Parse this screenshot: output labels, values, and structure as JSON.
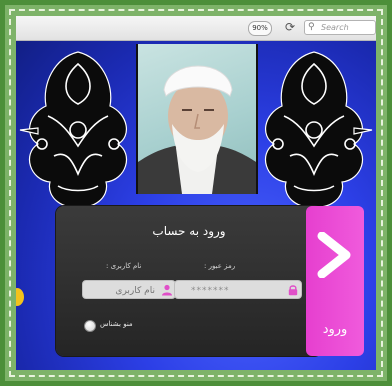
{
  "browser": {
    "zoom_level": "90%",
    "reload_glyph": "⟳",
    "search_icon_glyph": "⚲",
    "search_placeholder": "Search"
  },
  "login": {
    "title": "ورود به حساب",
    "username_label": ": نام کاربری",
    "username_placeholder": "نام کاربری",
    "password_label": ": رمز عبور",
    "password_value": "*******",
    "remember_label": "منو بشناس",
    "submit_label": "ورود"
  },
  "colors": {
    "background_blue": "#2c3fe6",
    "panel_dark": "#2e2e2e",
    "accent_magenta": "#ef4fd8",
    "frame_green": "#4d8f3a"
  },
  "icons": {
    "user": "user-icon",
    "lock": "lock-icon",
    "arrow": "chevron-right-icon"
  }
}
